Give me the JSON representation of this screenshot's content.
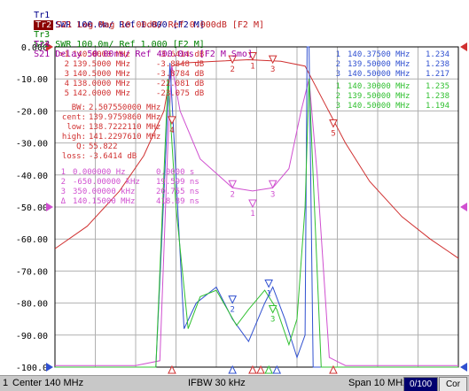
{
  "traces": {
    "tr1": {
      "label": "Tr1",
      "text": "S11 SWR 100.0m/ Ref 1.000 [F2 M]",
      "color": "#00008b"
    },
    "tr2": {
      "label": "Tr2",
      "text": "S21 Log Mag 10.00dB/ Ref 0.000dB [F2 M]",
      "color": "#c02020"
    },
    "tr3": {
      "label": "Tr3",
      "text": "S22 SWR 100.0m/ Ref 1.000 [F2 M]",
      "color": "#00a000"
    },
    "tr4": {
      "label": "Tr4",
      "text": "S21 Delay 50.00ns/ Ref 400.0ns [F2 M Smo]",
      "color": "#a000a0"
    }
  },
  "colors": {
    "tr1": "#3050d0",
    "tr2": "#d03030",
    "tr3": "#30c030",
    "tr4": "#d050d0",
    "grid": "#b0b0b0",
    "axis": "#000000"
  },
  "y_axis": {
    "labels": [
      "0.000",
      "-10.00",
      "-20.00",
      "-30.00",
      "-40.00",
      "-50.00",
      "-60.00",
      "-70.00",
      "-80.00",
      "-90.00",
      "-100.0"
    ]
  },
  "marker_table_tr2": [
    {
      "id": ">1",
      "freq": "140.0000 MHz",
      "val": "-3.6414 dB"
    },
    {
      "id": "2",
      "freq": "139.5000 MHz",
      "val": "-3.8848 dB"
    },
    {
      "id": "3",
      "freq": "140.5000 MHz",
      "val": "-3.8784 dB"
    },
    {
      "id": "4",
      "freq": "138.0000 MHz",
      "val": "-22.081 dB"
    },
    {
      "id": "5",
      "freq": "142.0000 MHz",
      "val": "-23.075 dB"
    }
  ],
  "bandwidth": {
    "bw_label": "BW:",
    "bw": "2.507550000 MHz",
    "cent_label": "cent:",
    "cent": "139.9759860 MHz",
    "low_label": "low:",
    "low": "138.7222110 MHz",
    "high_label": "high:",
    "high": "141.2297610 MHz",
    "q_label": "Q:",
    "q": "55.822",
    "loss_label": "loss:",
    "loss": "-3.6414 dB"
  },
  "marker_table_tr4": [
    {
      "id": "1",
      "freq": "0.000000 Hz",
      "val": "0.0000 s"
    },
    {
      "id": "2",
      "freq": "-650.00000 kHz",
      "val": "19.599 ns"
    },
    {
      "id": "3",
      "freq": "350.00000 kHz",
      "val": "20.755 ns"
    },
    {
      "id": "Δ",
      "freq": "140.15000 MHz",
      "val": "418.89 ns"
    }
  ],
  "marker_table_tr1": [
    {
      "id": "1",
      "freq": "140.37500 MHz",
      "val": "1.234"
    },
    {
      "id": "2",
      "freq": "139.50000 MHz",
      "val": "1.238"
    },
    {
      "id": "3",
      "freq": "140.50000 MHz",
      "val": "1.217"
    }
  ],
  "marker_table_tr3": [
    {
      "id": "1",
      "freq": "140.30000 MHz",
      "val": "1.235"
    },
    {
      "id": "2",
      "freq": "139.50000 MHz",
      "val": "1.238"
    },
    {
      "id": "3",
      "freq": "140.50000 MHz",
      "val": "1.194"
    }
  ],
  "status": {
    "channel": "1",
    "center": "Center 140 MHz",
    "ifbw": "IFBW 30 kHz",
    "span": "Span 10 MHz",
    "sweep_count": "0/100",
    "cor": "Cor"
  }
}
